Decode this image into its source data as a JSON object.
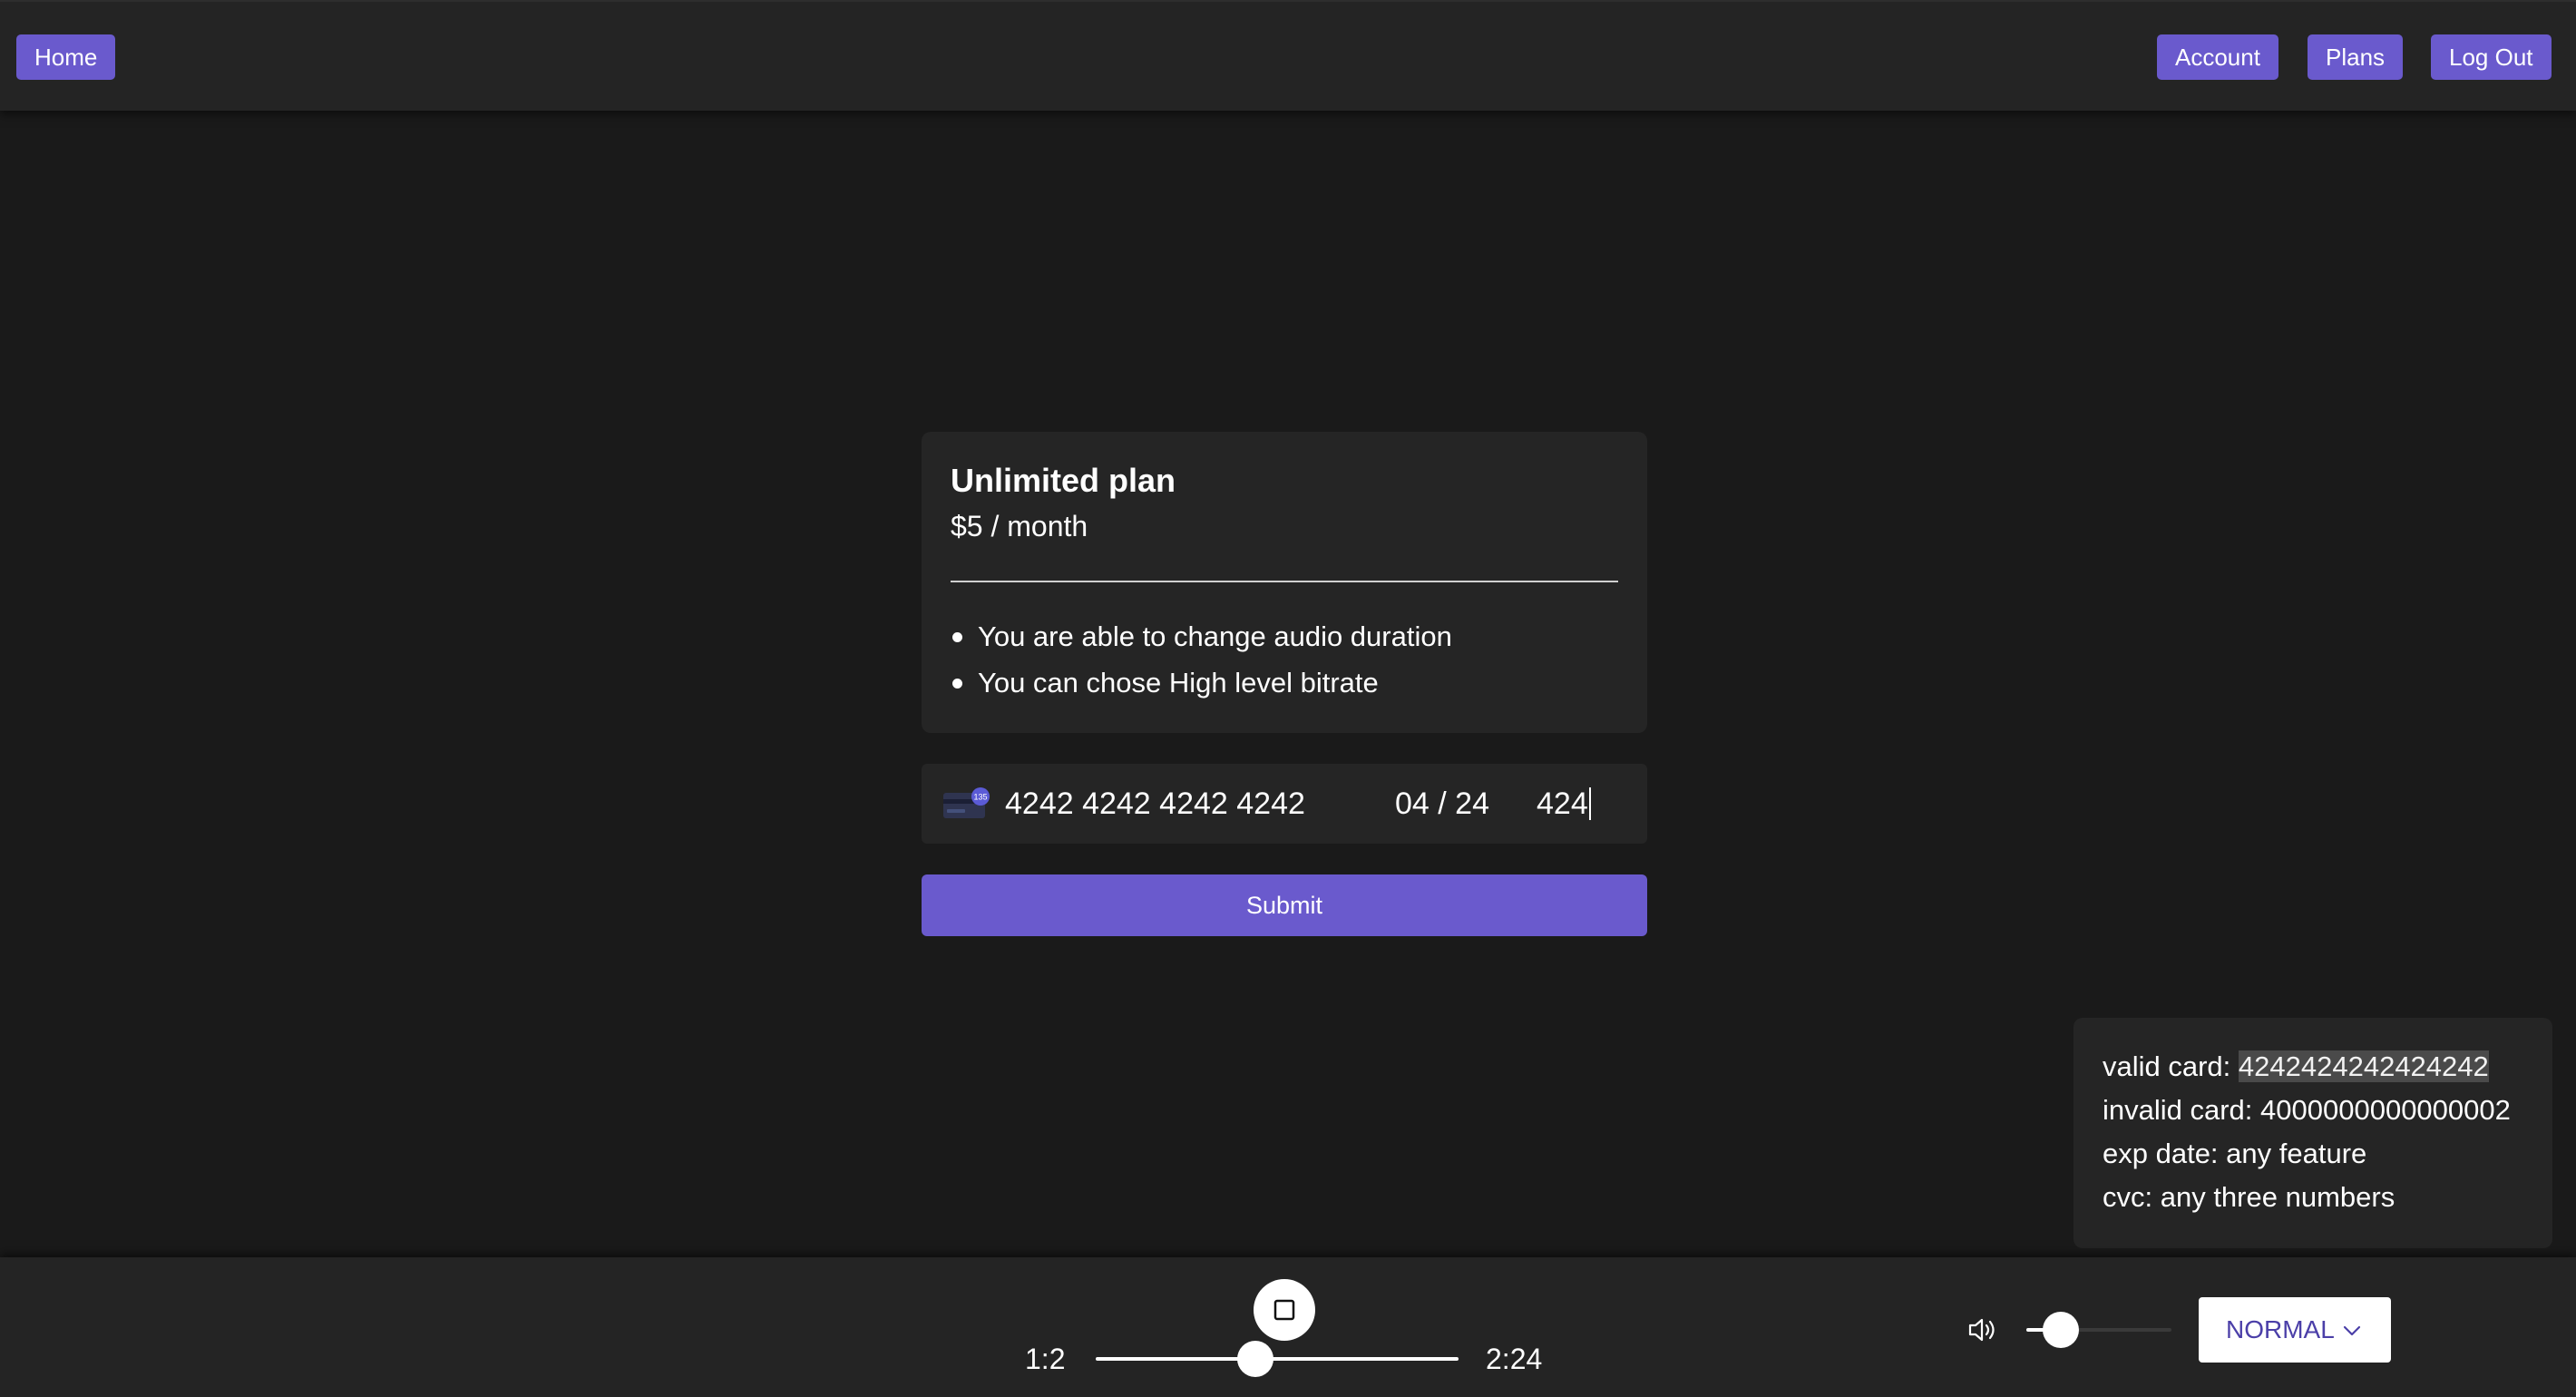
{
  "nav": {
    "home_label": "Home",
    "account_label": "Account",
    "plans_label": "Plans",
    "logout_label": "Log Out"
  },
  "plan": {
    "name": "Unlimited plan",
    "price": "$5 / month",
    "features": [
      "You are able to change audio duration",
      "You can chose High level bitrate"
    ]
  },
  "card_form": {
    "card_icon": "credit-card-icon",
    "card_number": "4242 4242 4242 4242",
    "expiry": "04 / 24",
    "cvc": "424",
    "submit_label": "Submit"
  },
  "test_hints": {
    "valid_label": "valid card: ",
    "valid_value": "4242424242424242",
    "invalid": "invalid card: 4000000000000002",
    "exp": "exp date: any feature",
    "cvc": "cvc: any three numbers"
  },
  "player": {
    "stop_icon": "stop-icon",
    "current_time": "1:2",
    "total_time": "2:24",
    "progress_fraction": 0.44,
    "volume_icon": "speaker-icon",
    "volume_fraction": 0.24,
    "speed_value": "NORMAL",
    "speed_icon": "chevron-down-icon"
  },
  "colors": {
    "accent": "#6a5acd",
    "background": "#1a1a1a",
    "surface": "#252525",
    "speed_text": "#4b3fa8"
  }
}
